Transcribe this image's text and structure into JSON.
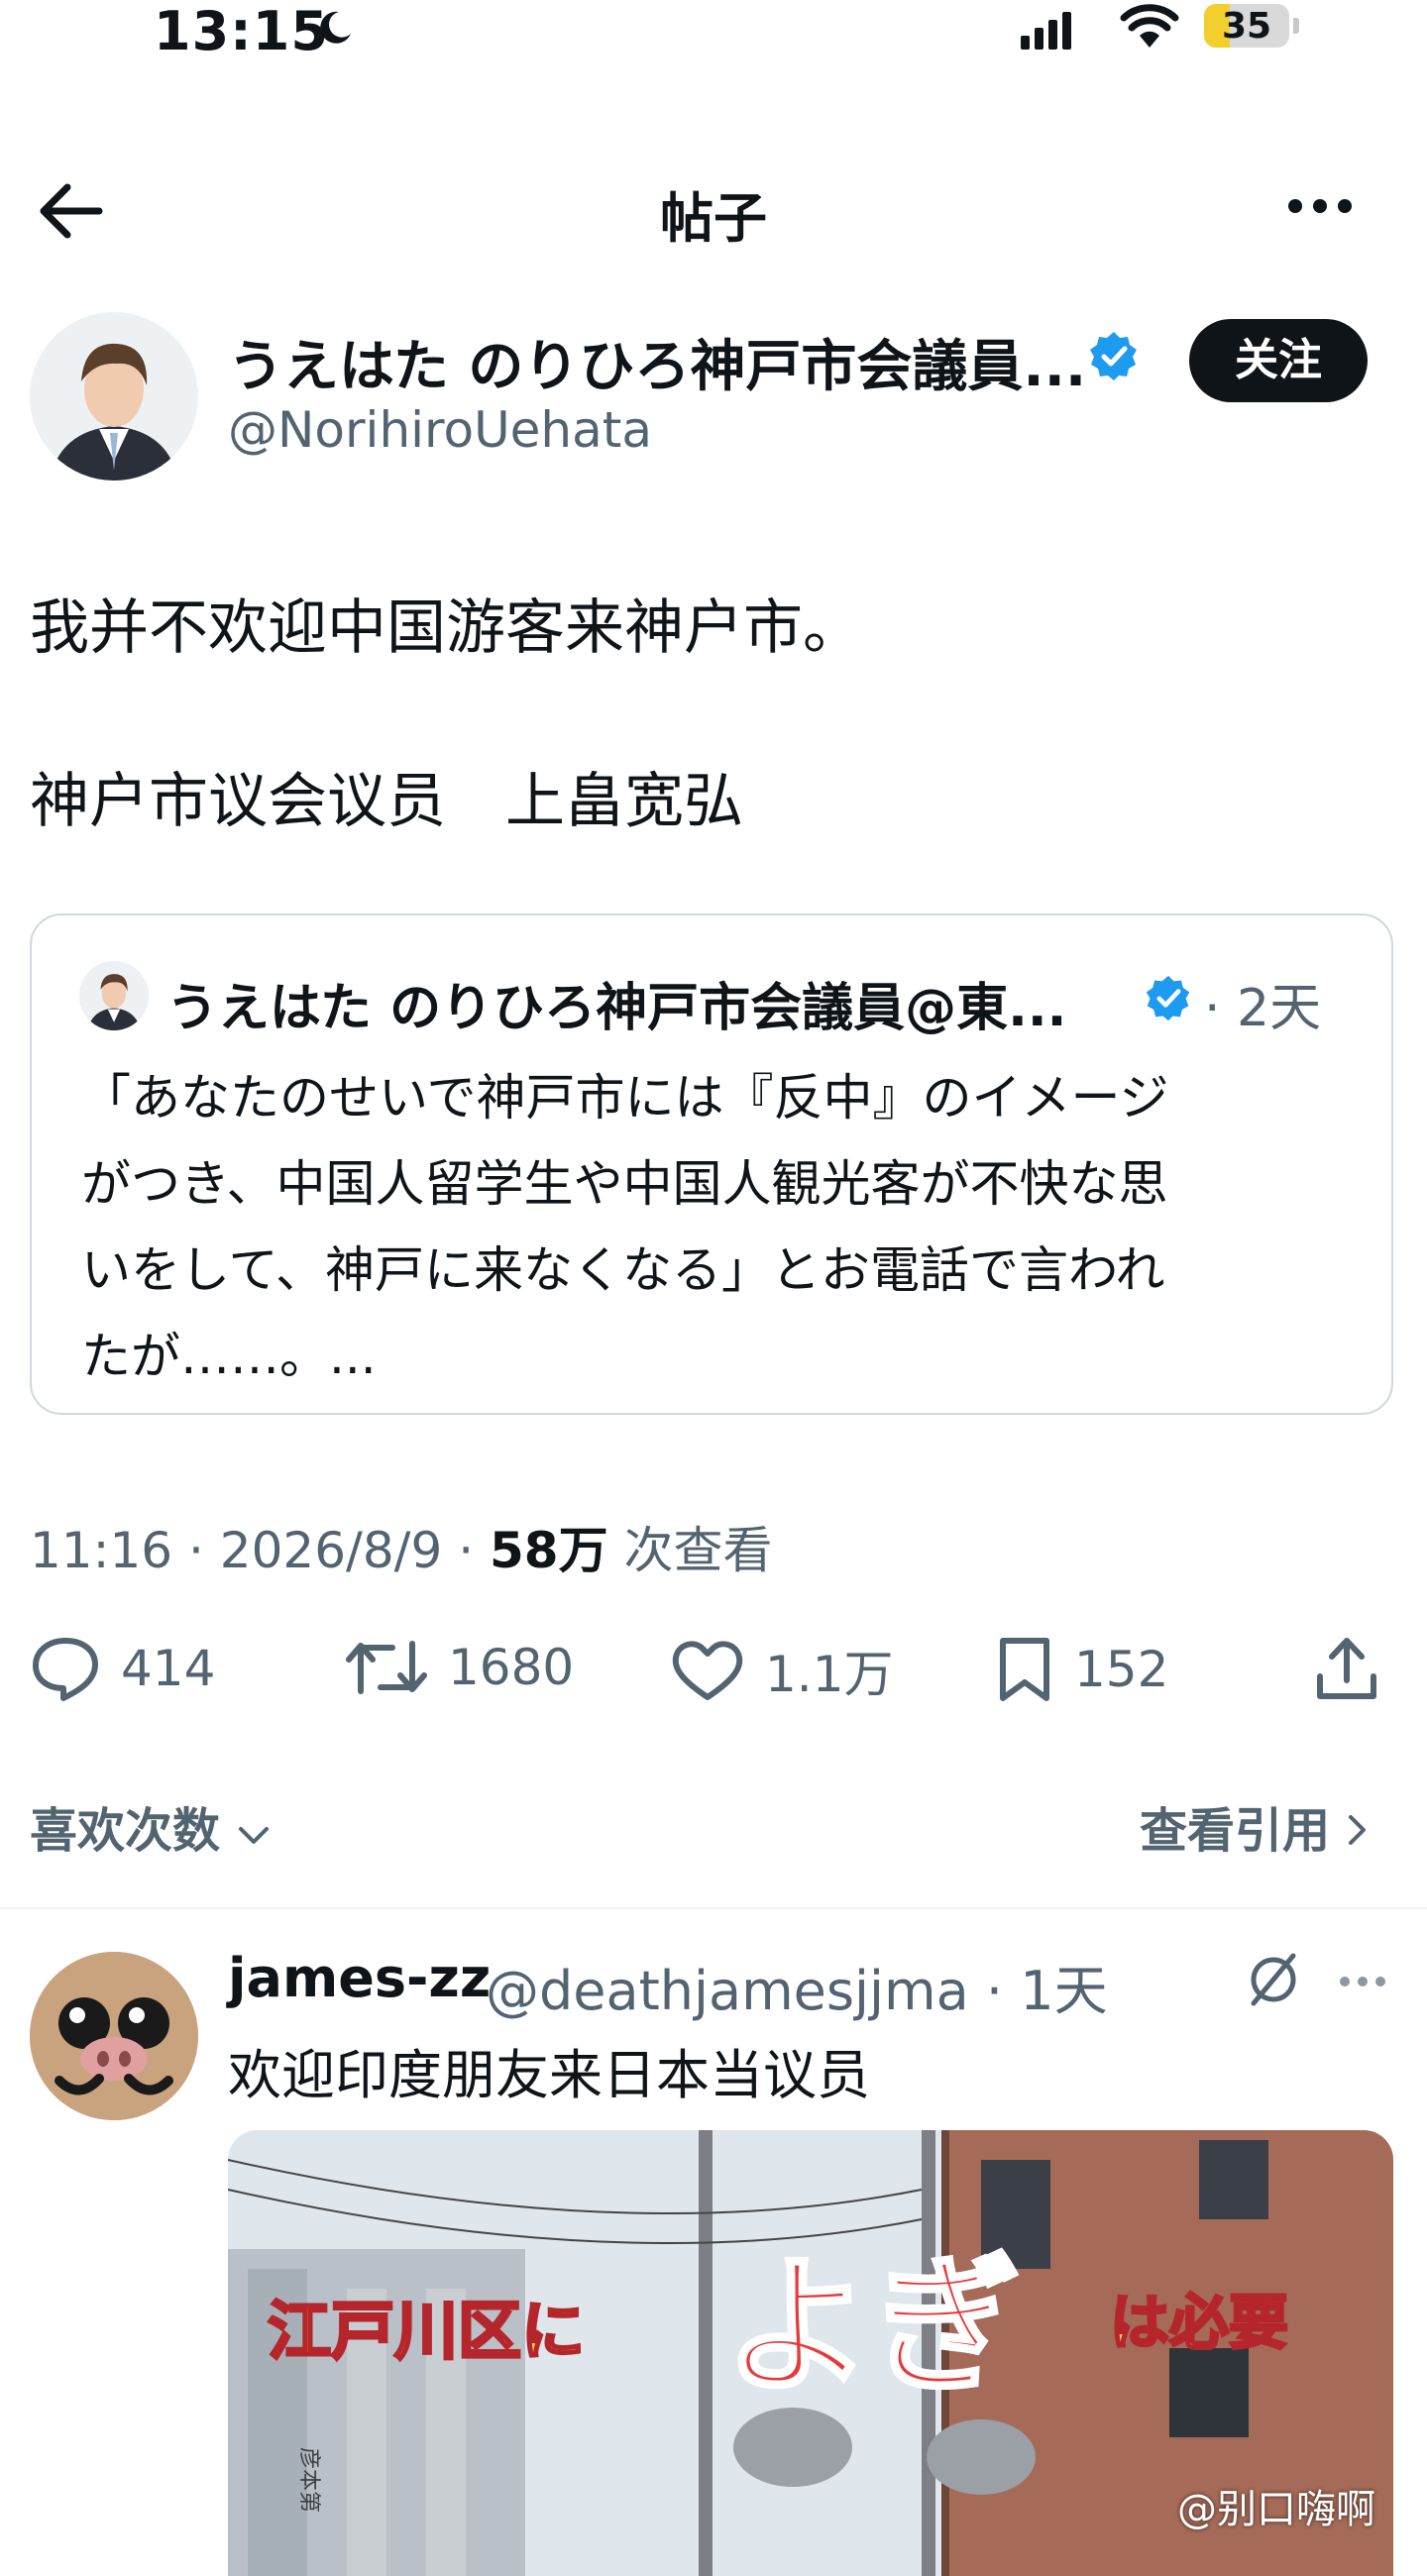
{
  "status_bar": {
    "time": "13:15",
    "battery": "35"
  },
  "header": {
    "title": "帖子"
  },
  "author": {
    "display_name": "うえはた のりひろ神戸市会議員...",
    "handle": "@NorihiroUehata",
    "follow_label": "关注"
  },
  "post": {
    "lines": [
      "我并不欢迎中国游客来神户市。",
      "神户市议会议员　上畠宽弘"
    ]
  },
  "quote": {
    "name": "うえはた のりひろ神戸市会議員@東...",
    "time": "· 2天",
    "lines": [
      "「あなたのせいで神戸市には『反中』のイメージ",
      "がつき、中国人留学生や中国人観光客が不快な思",
      "いをして、神戸に来なくなる」とお電話で言われ",
      "たが……。..."
    ]
  },
  "meta": {
    "time_date": "11:16 · 2026/8/9 · ",
    "views": "58万",
    "views_label": " 次查看"
  },
  "actions": {
    "replies": "414",
    "reposts": "1680",
    "likes": "1.1万",
    "bookmarks": "152"
  },
  "likes_row": "喜欢次数",
  "quotes_row": "查看引用",
  "reply": {
    "name": "james-zz",
    "handle": "@deathjamesjjma · 1天",
    "text": "欢迎印度朋友来日本当议员",
    "image_caption_left": "江戸川区に",
    "image_caption_big": "よぎ",
    "image_caption_right": "は必要",
    "building_text": "彦本第"
  },
  "watermark": "@别口嗨啊",
  "colors": {
    "text": "#0f1419",
    "secondary": "#536471",
    "verified": "#1d9bf0",
    "border": "#cfd9de"
  }
}
